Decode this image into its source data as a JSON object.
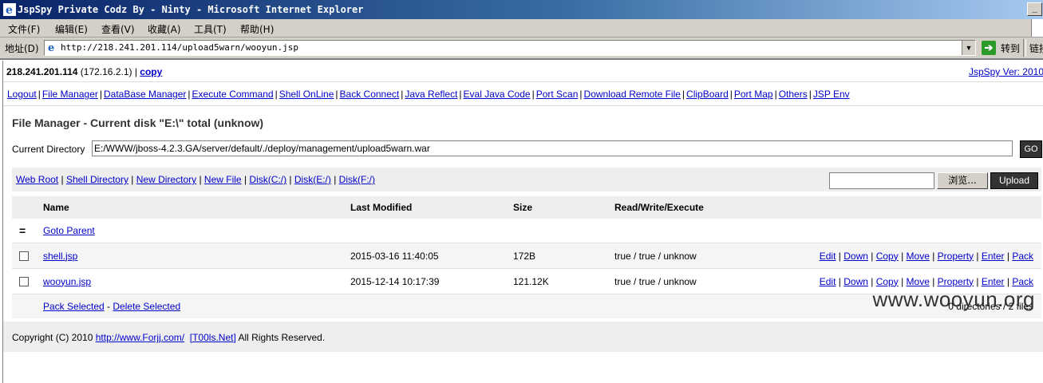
{
  "window": {
    "title": "JspSpy Private Codz By - Ninty - Microsoft Internet Explorer"
  },
  "menu": {
    "items": [
      "文件(F)",
      "编辑(E)",
      "查看(V)",
      "收藏(A)",
      "工具(T)",
      "帮助(H)"
    ]
  },
  "address_bar": {
    "label": "地址(D)",
    "url": "http://218.241.201.114/upload5warn/wooyun.jsp",
    "go_label": "转到",
    "links_label": "链接"
  },
  "header": {
    "host_ip": "218.241.201.114",
    "local_ip": "(172.16.2.1)",
    "copy_label": "copy",
    "version": "JspSpy Ver: 2010"
  },
  "nav": {
    "items": [
      "Logout",
      "File Manager",
      "DataBase Manager",
      "Execute Command",
      "Shell OnLine",
      "Back Connect",
      "Java Reflect",
      "Eval Java Code",
      "Port Scan",
      "Download Remote File",
      "ClipBoard",
      "Port Map",
      "Others",
      "JSP Env"
    ]
  },
  "file_manager": {
    "title": "File Manager - Current disk \"E:\\\" total (unknow)",
    "current_dir_label": "Current Directory",
    "current_dir": "E:/WWW/jboss-4.2.3.GA/server/default/./deploy/management/upload5warn.war",
    "go_label": "GO",
    "toolbar_links": [
      "Web Root",
      "Shell Directory",
      "New Directory",
      "New File",
      "Disk(C:/)",
      "Disk(E:/)",
      "Disk(F:/)"
    ],
    "browse_label": "浏览...",
    "upload_label": "Upload",
    "columns": [
      "Name",
      "Last Modified",
      "Size",
      "Read/Write/Execute"
    ],
    "parent_symbol": "=",
    "parent_label": "Goto Parent",
    "files": [
      {
        "name": "shell.jsp",
        "modified": "2015-03-16 11:40:05",
        "size": "172B",
        "perms": "true / true / unknow"
      },
      {
        "name": "wooyun.jsp",
        "modified": "2015-12-14 10:17:39",
        "size": "121.12K",
        "perms": "true / true / unknow"
      }
    ],
    "actions": [
      "Edit",
      "Down",
      "Copy",
      "Move",
      "Property",
      "Enter",
      "Pack"
    ],
    "pack_selected": "Pack Selected",
    "delete_selected": "Delete Selected",
    "summary": "0 directories / 2 files"
  },
  "footer": {
    "prefix": "Copyright (C) 2010",
    "link1": "http://www.Forjj.com/",
    "link2": "[T00ls.Net]",
    "suffix": "All Rights Reserved."
  },
  "watermark": "www.wooyun.org"
}
